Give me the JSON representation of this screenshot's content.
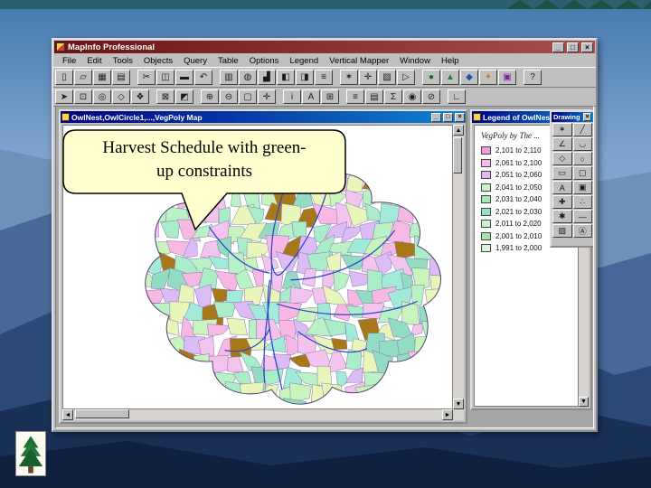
{
  "window": {
    "title": "MapInfo Professional",
    "controls": {
      "minimize": "_",
      "maximize": "□",
      "close": "×"
    }
  },
  "menu": {
    "items": [
      "File",
      "Edit",
      "Tools",
      "Objects",
      "Query",
      "Table",
      "Options",
      "Legend",
      "Vertical Mapper",
      "Window",
      "Help"
    ]
  },
  "toolbars": {
    "row1": [
      {
        "name": "new-table-icon",
        "g": "▯"
      },
      {
        "name": "open-table-icon",
        "g": "▱"
      },
      {
        "name": "save-table-icon",
        "g": "▦"
      },
      {
        "name": "print-icon",
        "g": "▤"
      },
      {
        "sep": true
      },
      {
        "name": "cut-icon",
        "g": "✂"
      },
      {
        "name": "copy-icon",
        "g": "◫"
      },
      {
        "name": "paste-icon",
        "g": "▬"
      },
      {
        "name": "undo-icon",
        "g": "↶"
      },
      {
        "sep": true
      },
      {
        "name": "new-browser-icon",
        "g": "▥"
      },
      {
        "name": "new-mapper-icon",
        "g": "◍"
      },
      {
        "name": "new-grapher-icon",
        "g": "▟"
      },
      {
        "name": "new-layout-icon",
        "g": "◧"
      },
      {
        "name": "new-redistricter-icon",
        "g": "◨"
      },
      {
        "name": "district-browser-icon",
        "g": "≡"
      },
      {
        "sep": true
      },
      {
        "name": "hotlink-icon",
        "g": "✶"
      },
      {
        "name": "geocode-icon",
        "g": "✛"
      },
      {
        "name": "crystal-reports-icon",
        "g": "▨"
      },
      {
        "name": "run-mapbasic-icon",
        "g": "▷"
      },
      {
        "sep": true
      },
      {
        "name": "web-services-icon",
        "g": "●",
        "c": "#1a6a1a"
      },
      {
        "name": "mapping-wizard-icon",
        "g": "▲",
        "c": "#2e7d32"
      },
      {
        "name": "grid-tools-icon",
        "g": "◆",
        "c": "#1f4fa8"
      },
      {
        "name": "raster-tools-icon",
        "g": "✦",
        "c": "#b8860b"
      },
      {
        "name": "layout-view-icon",
        "g": "▣",
        "c": "#7a1fa8"
      },
      {
        "sep": true
      },
      {
        "name": "help-icon",
        "g": "?"
      }
    ],
    "row2": [
      {
        "name": "select-icon",
        "g": "➤"
      },
      {
        "name": "marquee-select-icon",
        "g": "⊡"
      },
      {
        "name": "radius-select-icon",
        "g": "◎"
      },
      {
        "name": "polygon-select-icon",
        "g": "◇"
      },
      {
        "name": "boundary-select-icon",
        "g": "❖"
      },
      {
        "sep": true
      },
      {
        "name": "unselect-all-icon",
        "g": "⊠"
      },
      {
        "name": "invert-selection-icon",
        "g": "◩"
      },
      {
        "sep": true
      },
      {
        "name": "zoom-in-icon",
        "g": "⊕"
      },
      {
        "name": "zoom-out-icon",
        "g": "⊖"
      },
      {
        "name": "change-view-icon",
        "g": "▢"
      },
      {
        "name": "grabber-icon",
        "g": "✛"
      },
      {
        "sep": true
      },
      {
        "name": "info-icon",
        "g": "i"
      },
      {
        "name": "label-icon",
        "g": "A"
      },
      {
        "name": "drag-map-window-icon",
        "g": "⊞"
      },
      {
        "sep": true
      },
      {
        "name": "layer-control-icon",
        "g": "≡"
      },
      {
        "name": "show-legend-icon",
        "g": "▤"
      },
      {
        "name": "statistics-icon",
        "g": "Σ"
      },
      {
        "name": "set-target-icon",
        "g": "◉"
      },
      {
        "name": "clip-region-icon",
        "g": "⊘"
      },
      {
        "sep": true
      },
      {
        "name": "ruler-icon",
        "g": "∟"
      }
    ]
  },
  "map_window": {
    "title": "OwlNest,OwlCircle1,...,VegPoly Map",
    "controls": {
      "minimize": "_",
      "maximize": "□",
      "close": "×"
    }
  },
  "legend_window": {
    "title": "Legend of OwlNest",
    "heading": "VegPoly by The ...",
    "controls": {
      "minimize": "_",
      "maximize": "□",
      "close": "×"
    },
    "entries": [
      {
        "color": "#f0a0d8",
        "label": "2,101 to 2,110"
      },
      {
        "color": "#f6bce6",
        "label": "2,061 to 2,100"
      },
      {
        "color": "#e2b6f2",
        "label": "2,051 to 2,060"
      },
      {
        "color": "#caf2cf",
        "label": "2,041 to 2,050"
      },
      {
        "color": "#a9e8b4",
        "label": "2,031 to 2,040"
      },
      {
        "color": "#8fe0cc",
        "label": "2,021 to 2,030"
      },
      {
        "color": "#c6f4cb",
        "label": "2,011 to 2,020"
      },
      {
        "color": "#a2e4ac",
        "label": "2,001 to 2,010"
      },
      {
        "color": "#d9f7de",
        "label": "1,991 to 2,000"
      }
    ]
  },
  "drawing_palette": {
    "title": "Drawing",
    "close": "×",
    "tools": [
      {
        "name": "symbol-tool-icon",
        "g": "✶"
      },
      {
        "name": "line-tool-icon",
        "g": "╱"
      },
      {
        "name": "polyline-tool-icon",
        "g": "∠"
      },
      {
        "name": "arc-tool-icon",
        "g": "◡"
      },
      {
        "name": "polygon-tool-icon",
        "g": "◇"
      },
      {
        "name": "ellipse-tool-icon",
        "g": "○"
      },
      {
        "name": "rectangle-tool-icon",
        "g": "▭"
      },
      {
        "name": "rounded-rectangle-tool-icon",
        "g": "▢"
      },
      {
        "name": "text-tool-icon",
        "g": "A"
      },
      {
        "name": "frame-tool-icon",
        "g": "▣"
      },
      {
        "name": "reshape-tool-icon",
        "g": "✚"
      },
      {
        "name": "add-node-tool-icon",
        "g": "∴"
      },
      {
        "name": "symbol-style-icon",
        "g": "✱"
      },
      {
        "name": "line-style-icon",
        "g": "—"
      },
      {
        "name": "region-style-icon",
        "g": "▨"
      },
      {
        "name": "text-style-icon",
        "g": "Ⓐ"
      }
    ]
  },
  "scrollbar": {
    "up": "▲",
    "down": "▼",
    "left": "◄",
    "right": "►"
  },
  "callout": {
    "line1": "Harvest Schedule with green-",
    "line2": "up constraints"
  },
  "map": {
    "palette": [
      "#b9f2c4",
      "#aaedc9",
      "#f7b9e4",
      "#dcbcf6",
      "#a2ead9",
      "#c9f4bb",
      "#f3c4ee",
      "#93dcc4",
      "#e8f6b9"
    ],
    "brown": "#a87818",
    "stream_color": "#2a46c8",
    "streams": [
      "M258,58 C250,95 238,120 240,160 C242,195 228,240 232,300",
      "M305,72 C295,108 278,140 258,165 C250,175 244,182 240,160",
      "M168,118 C188,148 210,168 238,172",
      "M382,122 C360,152 320,178 262,180",
      "M408,205 C368,222 312,228 246,208",
      "M238,180 C230,225 244,268 252,308",
      "M186,262 C214,268 232,252 238,236",
      "M350,260 C330,270 300,262 270,240"
    ]
  },
  "colors": {
    "chrome": "#c0c0c0",
    "titlebar_main": "#6b1414",
    "titlebar_main_light": "#a85050",
    "titlebar_child": "#000080",
    "titlebar_child_light": "#1084d0",
    "callout_bg": "#ffffcf"
  }
}
